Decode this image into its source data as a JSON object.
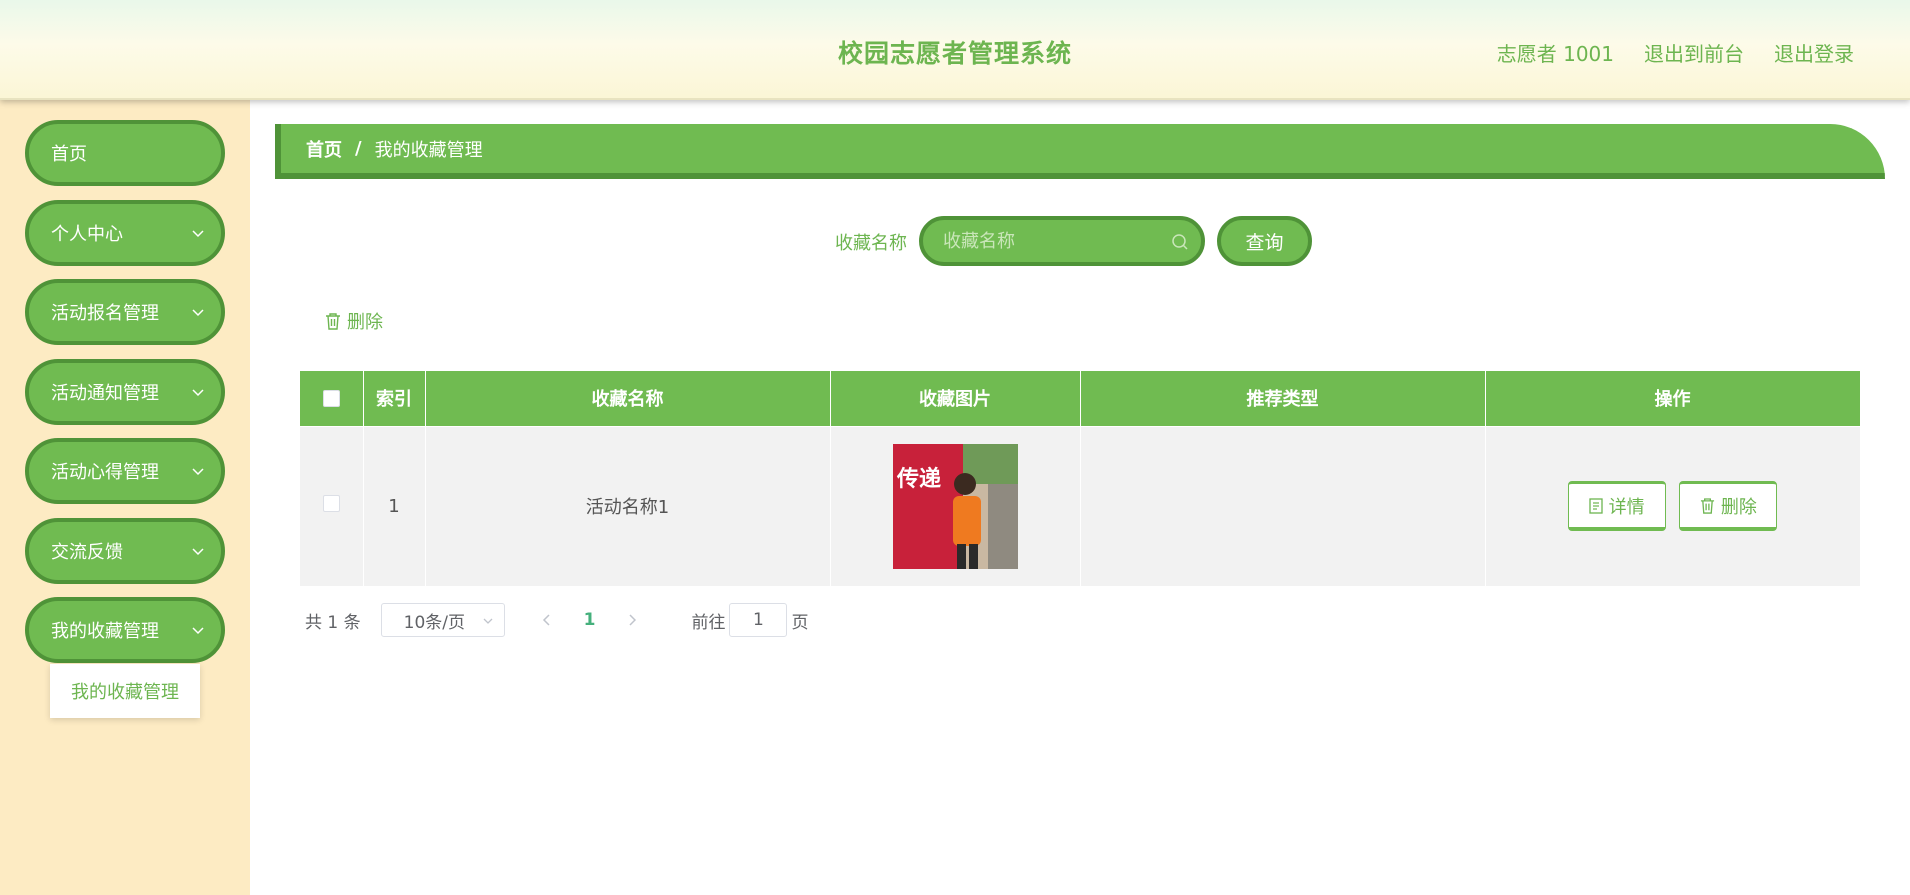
{
  "header": {
    "title": "校园志愿者管理系统",
    "user": "志愿者 1001",
    "to_front": "退出到前台",
    "logout": "退出登录"
  },
  "sidebar": {
    "items": [
      {
        "label": "首页",
        "icon": "none"
      },
      {
        "label": "个人中心",
        "icon": "chevron-down-icon"
      },
      {
        "label": "活动报名管理",
        "icon": "chevron-down-icon"
      },
      {
        "label": "活动通知管理",
        "icon": "chevron-down-icon"
      },
      {
        "label": "活动心得管理",
        "icon": "chevron-down-icon"
      },
      {
        "label": "交流反馈",
        "icon": "chevron-down-icon"
      },
      {
        "label": "我的收藏管理",
        "icon": "chevron-down-icon"
      }
    ],
    "submenu": {
      "label": "我的收藏管理"
    }
  },
  "breadcrumb": {
    "home": "首页",
    "separator": "/",
    "current": "我的收藏管理"
  },
  "search": {
    "label": "收藏名称",
    "placeholder": "收藏名称",
    "button": "查询"
  },
  "toolbar": {
    "delete_label": "删除"
  },
  "table": {
    "columns": [
      "",
      "索引",
      "收藏名称",
      "收藏图片",
      "推荐类型",
      "操作"
    ],
    "rows": [
      {
        "index": "1",
        "name": "活动名称1",
        "image_text": "传递",
        "type": "",
        "detail": "详情",
        "delete": "删除"
      }
    ]
  },
  "pagination": {
    "total": "共 1 条",
    "page_size": "10条/页",
    "current_page": "1",
    "goto_label": "前往",
    "goto_value": "1",
    "page_suffix": "页"
  },
  "colors": {
    "accent": "#70bb51",
    "accent_dark": "#4f9338",
    "sidebar_bg": "#fdebc3",
    "header_text": "#6db550"
  }
}
